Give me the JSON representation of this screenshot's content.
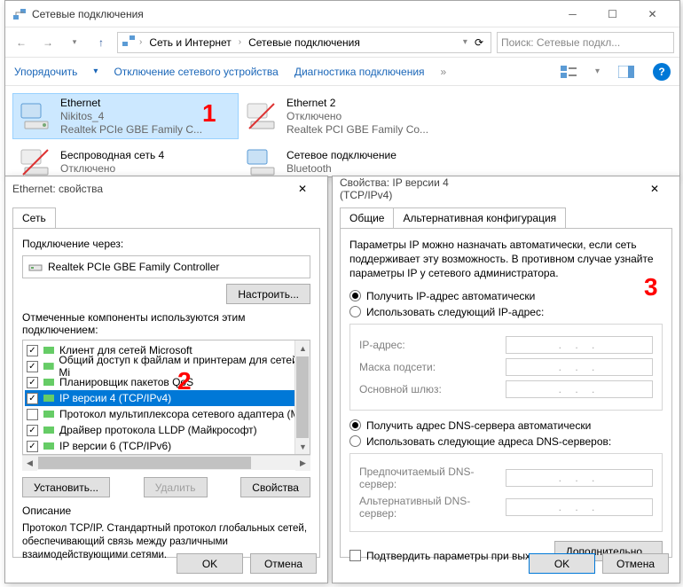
{
  "explorer": {
    "title": "Сетевые подключения",
    "breadcrumb": [
      "Сеть и Интернет",
      "Сетевые подключения"
    ],
    "search_placeholder": "Поиск: Сетевые подкл...",
    "cmd": {
      "organize": "Упорядочить",
      "disable": "Отключение сетевого устройства",
      "diagnose": "Диагностика подключения"
    },
    "connections": [
      {
        "name": "Ethernet",
        "line2": "Nikitos_4",
        "line3": "Realtek PCIe GBE Family C...",
        "selected": true
      },
      {
        "name": "Ethernet 2",
        "line2": "Отключено",
        "line3": "Realtek PCI GBE Family Co..."
      },
      {
        "name": "Беспроводная сеть 4",
        "line2": "Отключено",
        "line3": ""
      },
      {
        "name": "Сетевое подключение",
        "line2": "Bluetooth",
        "line3": ""
      }
    ]
  },
  "props": {
    "title": "Ethernet: свойства",
    "tab": "Сеть",
    "connect_via": "Подключение через:",
    "adapter": "Realtek PCIe GBE Family Controller",
    "configure": "Настроить...",
    "components_label": "Отмеченные компоненты используются этим подключением:",
    "components": [
      "Клиент для сетей Microsoft",
      "Общий доступ к файлам и принтерам для сетей Mi",
      "Планировщик пакетов QoS",
      "IP версии 4 (TCP/IPv4)",
      "Протокол мультиплексора сетевого адаптера (Ма",
      "Драйвер протокола LLDP (Майкрософт)",
      "IP версии 6 (TCP/IPv6)"
    ],
    "install": "Установить...",
    "uninstall": "Удалить",
    "properties": "Свойства",
    "desc_label": "Описание",
    "desc_text": "Протокол TCP/IP. Стандартный протокол глобальных сетей, обеспечивающий связь между различными взаимодействующими сетями.",
    "ok": "OK",
    "cancel": "Отмена"
  },
  "ipv4": {
    "title": "Свойства: IP версии 4 (TCP/IPv4)",
    "tabs": [
      "Общие",
      "Альтернативная конфигурация"
    ],
    "info": "Параметры IP можно назначать автоматически, если сеть поддерживает эту возможность. В противном случае узнайте параметры IP у сетевого администратора.",
    "radio_auto_ip": "Получить IP-адрес автоматически",
    "radio_manual_ip": "Использовать следующий IP-адрес:",
    "ip_address": "IP-адрес:",
    "subnet": "Маска подсети:",
    "gateway": "Основной шлюз:",
    "radio_auto_dns": "Получить адрес DNS-сервера автоматически",
    "radio_manual_dns": "Использовать следующие адреса DNS-серверов:",
    "dns_pref": "Предпочитаемый DNS-сервер:",
    "dns_alt": "Альтернативный DNS-сервер:",
    "validate": "Подтвердить параметры при выходе",
    "advanced": "Дополнительно...",
    "ok": "OK",
    "cancel": "Отмена"
  },
  "annotations": {
    "a1": "1",
    "a2": "2",
    "a3": "3"
  }
}
